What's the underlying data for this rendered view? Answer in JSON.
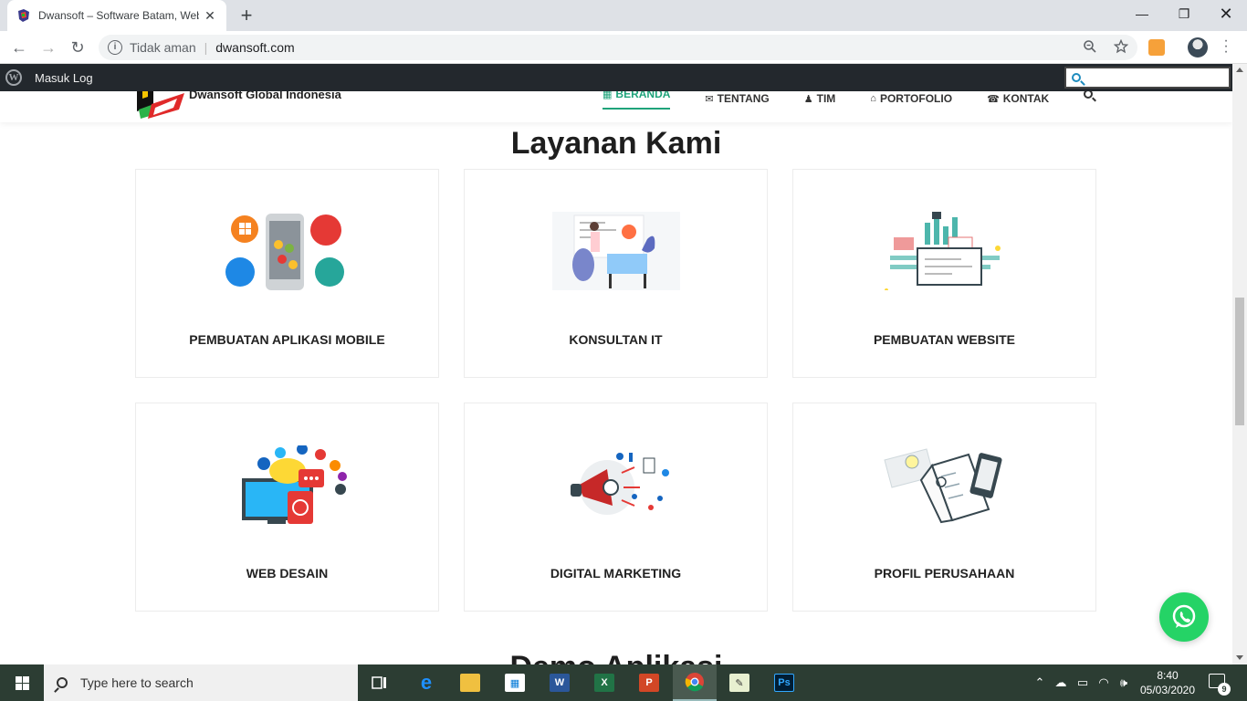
{
  "browser": {
    "tab_title": "Dwansoft – Software Batam, Web",
    "address_security": "Tidak aman",
    "address_url": "dwansoft.com"
  },
  "wp_admin_bar": {
    "login_label": "Masuk Log"
  },
  "site": {
    "brand_name": "Dwansoft Global Indonesia",
    "nav": [
      {
        "label": "BERANDA",
        "icon": "grid-icon",
        "active": true
      },
      {
        "label": "TENTANG",
        "icon": "envelope-icon"
      },
      {
        "label": "TIM",
        "icon": "user-icon"
      },
      {
        "label": "PORTOFOLIO",
        "icon": "bank-icon"
      },
      {
        "label": "KONTAK",
        "icon": "phone-icon"
      }
    ],
    "section_title": "Layanan Kami",
    "services": [
      {
        "label": "PEMBUATAN APLIKASI MOBILE",
        "icon": "mobile-development-illustration"
      },
      {
        "label": "KONSULTAN IT",
        "icon": "consultant-presentation-illustration"
      },
      {
        "label": "PEMBUATAN WEBSITE",
        "icon": "website-code-illustration"
      },
      {
        "label": "WEB DESAIN",
        "icon": "web-design-social-illustration"
      },
      {
        "label": "DIGITAL MARKETING",
        "icon": "megaphone-marketing-illustration"
      },
      {
        "label": "PROFIL PERUSAHAAN",
        "icon": "company-profile-illustration"
      }
    ],
    "next_section_title": "Demo Aplikasi"
  },
  "taskbar": {
    "search_placeholder": "Type here to search",
    "time": "8:40",
    "date": "05/03/2020",
    "notification_count": "9"
  },
  "colors": {
    "accent": "#1fa37a",
    "whatsapp": "#25d366",
    "wp_bar": "#23282d",
    "taskbar": "#2c3d33"
  }
}
